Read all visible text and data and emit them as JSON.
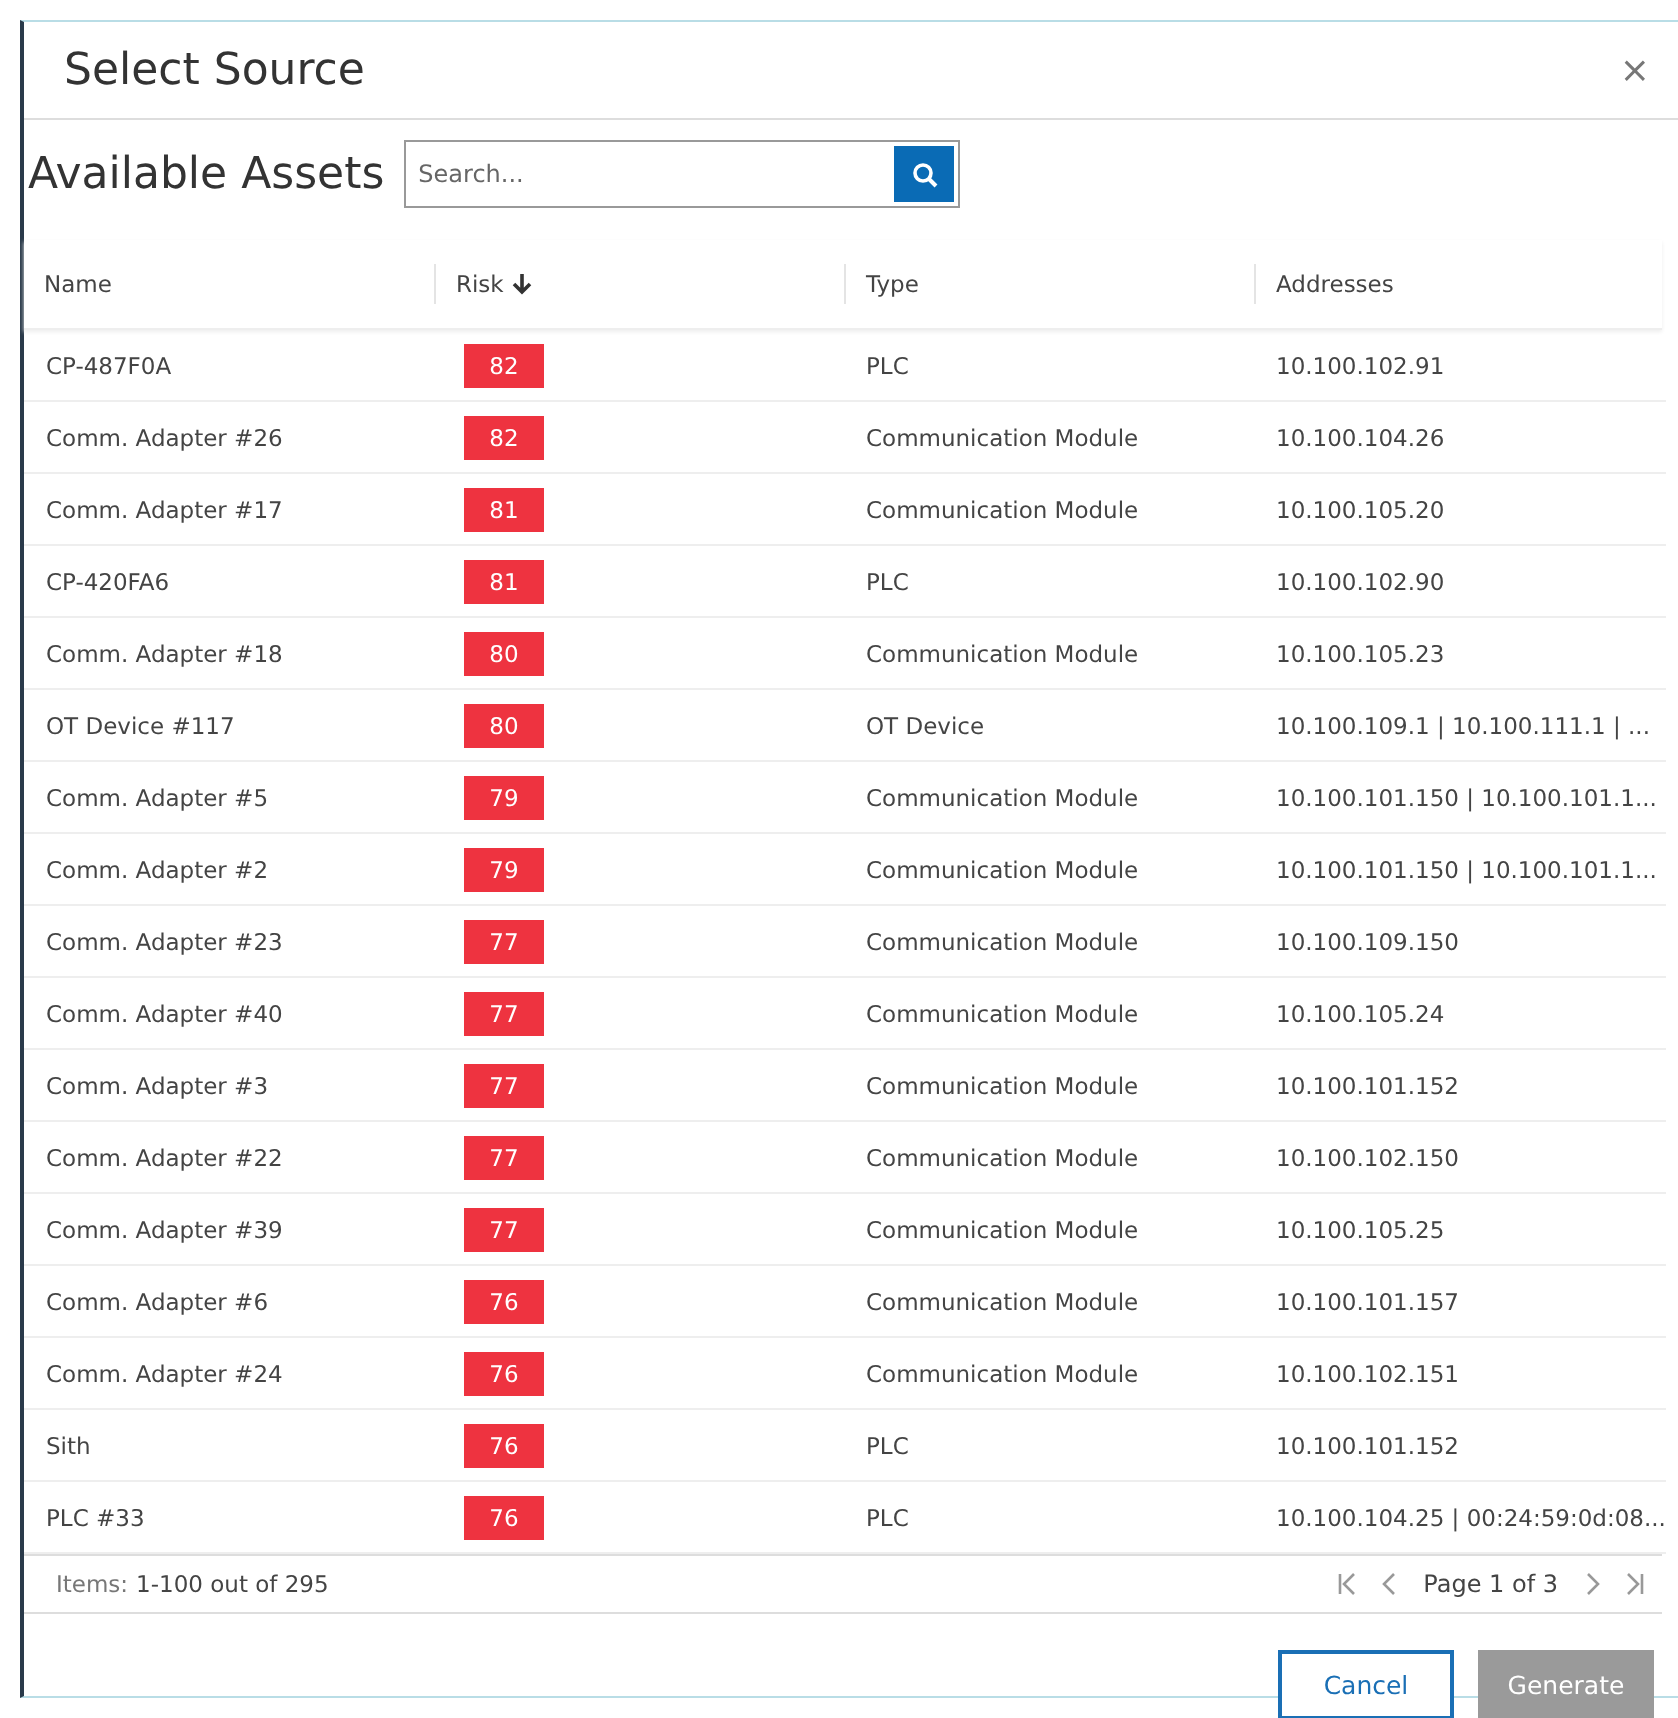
{
  "dialog": {
    "title": "Select Source",
    "close": "×"
  },
  "section_title": "Available Assets",
  "search": {
    "placeholder": "Search..."
  },
  "table": {
    "columns": [
      {
        "label": "Name",
        "sorted": false
      },
      {
        "label": "Risk",
        "sorted": true
      },
      {
        "label": "Type",
        "sorted": false
      },
      {
        "label": "Addresses",
        "sorted": false
      }
    ],
    "rows": [
      {
        "name": "CP-487F0A",
        "risk": "82",
        "type": "PLC",
        "addresses": "10.100.102.91"
      },
      {
        "name": "Comm. Adapter #26",
        "risk": "82",
        "type": "Communication Module",
        "addresses": "10.100.104.26"
      },
      {
        "name": "Comm. Adapter #17",
        "risk": "81",
        "type": "Communication Module",
        "addresses": "10.100.105.20"
      },
      {
        "name": "CP-420FA6",
        "risk": "81",
        "type": "PLC",
        "addresses": "10.100.102.90"
      },
      {
        "name": "Comm. Adapter #18",
        "risk": "80",
        "type": "Communication Module",
        "addresses": "10.100.105.23"
      },
      {
        "name": "OT Device #117",
        "risk": "80",
        "type": "OT Device",
        "addresses": "10.100.109.1 | 10.100.111.1 | ..."
      },
      {
        "name": "Comm. Adapter #5",
        "risk": "79",
        "type": "Communication Module",
        "addresses": "10.100.101.150 | 10.100.101.1..."
      },
      {
        "name": "Comm. Adapter #2",
        "risk": "79",
        "type": "Communication Module",
        "addresses": "10.100.101.150 | 10.100.101.1..."
      },
      {
        "name": "Comm. Adapter #23",
        "risk": "77",
        "type": "Communication Module",
        "addresses": "10.100.109.150"
      },
      {
        "name": "Comm. Adapter #40",
        "risk": "77",
        "type": "Communication Module",
        "addresses": "10.100.105.24"
      },
      {
        "name": "Comm. Adapter #3",
        "risk": "77",
        "type": "Communication Module",
        "addresses": "10.100.101.152"
      },
      {
        "name": "Comm. Adapter #22",
        "risk": "77",
        "type": "Communication Module",
        "addresses": "10.100.102.150"
      },
      {
        "name": "Comm. Adapter #39",
        "risk": "77",
        "type": "Communication Module",
        "addresses": "10.100.105.25"
      },
      {
        "name": "Comm. Adapter #6",
        "risk": "76",
        "type": "Communication Module",
        "addresses": "10.100.101.157"
      },
      {
        "name": "Comm. Adapter #24",
        "risk": "76",
        "type": "Communication Module",
        "addresses": "10.100.102.151"
      },
      {
        "name": "Sith",
        "risk": "76",
        "type": "PLC",
        "addresses": "10.100.101.152"
      },
      {
        "name": "PLC #33",
        "risk": "76",
        "type": "PLC",
        "addresses": "10.100.104.25 | 00:24:59:0d:08..."
      }
    ]
  },
  "pager": {
    "items_label": "Items:",
    "items_range": "1-100 out of 295",
    "page": "Page 1 of 3"
  },
  "buttons": [
    {
      "label": "Cancel",
      "disabled": false,
      "kind": "secondary"
    },
    {
      "label": "Generate",
      "disabled": true,
      "kind": "primary"
    }
  ]
}
